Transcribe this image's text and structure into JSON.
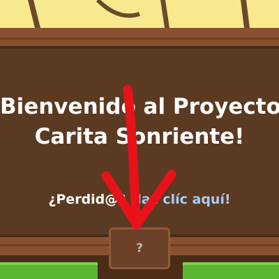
{
  "board": {
    "title_line1": "Bienvenido al Proyecto",
    "title_line2": "Carita Sonriente!",
    "lost_question": "¿Perdid@?",
    "help_link_text": "Haz clíc aquí!"
  },
  "help_button": {
    "label": "?"
  },
  "colors": {
    "board": "#5b3a22",
    "plank": "#8a5130",
    "sky": "#f7e98e",
    "grass": "#5ab532",
    "link": "#a9cbf5",
    "arrow": "#e8121b"
  },
  "icons": {
    "arrow": "down-arrow-icon",
    "help": "question-mark-icon"
  }
}
